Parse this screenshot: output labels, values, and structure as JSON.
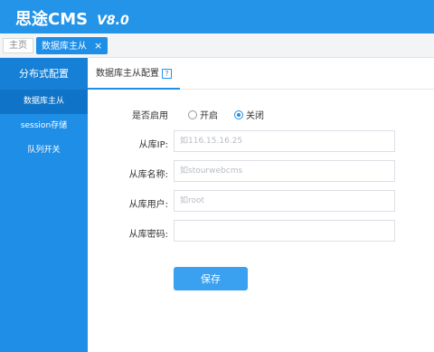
{
  "header": {
    "brand": "思途CMS",
    "version": "V8.0"
  },
  "tabs": {
    "home": "主页",
    "active": "数据库主从",
    "close": "×"
  },
  "sidebar": {
    "title": "分布式配置",
    "items": [
      {
        "label": "数据库主从",
        "active": true
      },
      {
        "label": "session存储",
        "active": false
      },
      {
        "label": "队列开关",
        "active": false
      }
    ]
  },
  "subheader": {
    "tab": "数据库主从配置",
    "help": "?"
  },
  "form": {
    "enable_label": "是否启用",
    "enable_options": [
      {
        "label": "开启",
        "checked": false
      },
      {
        "label": "关闭",
        "checked": true
      }
    ],
    "fields": [
      {
        "label": "从库IP:",
        "placeholder": "如116.15.16.25",
        "value": ""
      },
      {
        "label": "从库名称:",
        "placeholder": "如stourwebcms",
        "value": ""
      },
      {
        "label": "从库用户:",
        "placeholder": "如root",
        "value": ""
      },
      {
        "label": "从库密码:",
        "placeholder": "",
        "value": ""
      }
    ],
    "save_label": "保存"
  },
  "colors": {
    "primary": "#2394e8",
    "sidebar": "#1f8ee6",
    "sidebar_active": "#0f74c8",
    "button": "#3aa0f0"
  }
}
